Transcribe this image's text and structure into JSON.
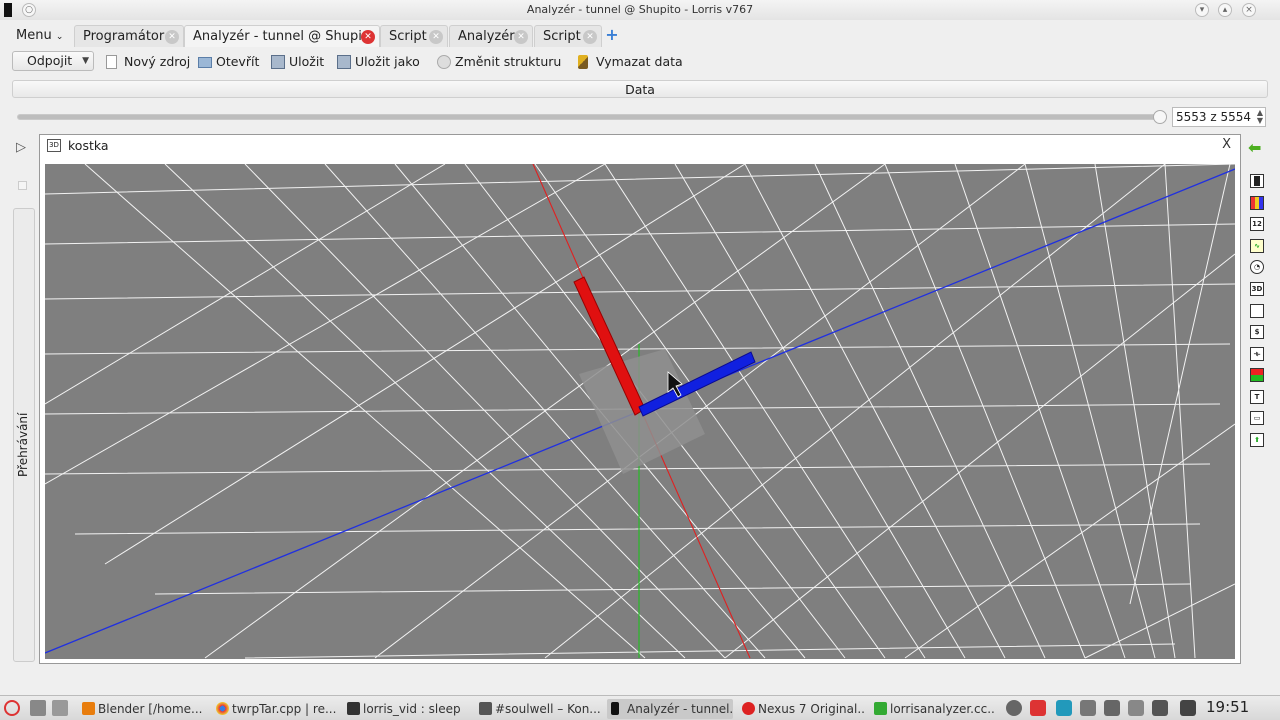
{
  "window": {
    "title": "Analyzér - tunnel @ Shupito - Lorris v767"
  },
  "tabbar": {
    "menu_label": "Menu",
    "tabs": [
      {
        "label": "Programátor"
      },
      {
        "label": "Analyzér - tunnel @ Shupi..."
      },
      {
        "label": "Script"
      },
      {
        "label": "Analyzér"
      },
      {
        "label": "Script"
      }
    ]
  },
  "toolbar": {
    "connection_combo": "Odpojit",
    "new_source": "Nový zdroj",
    "open": "Otevřít",
    "save": "Uložit",
    "save_as": "Uložit jako",
    "change_structure": "Změnit strukturu",
    "clear_data": "Vymazat data"
  },
  "data_bar": {
    "label": "Data"
  },
  "playback": {
    "position_text": "5553 z 5554",
    "progress": 0.9998,
    "tab_label": "Přehrávání"
  },
  "widget": {
    "title": "kostka",
    "type_icon": "3D",
    "close_label": "X"
  },
  "right_palette": [
    {
      "icon": "battery-icon"
    },
    {
      "icon": "color-bars-icon"
    },
    {
      "icon": "number-icon",
      "text": "12"
    },
    {
      "icon": "graph-icon"
    },
    {
      "icon": "clock-icon"
    },
    {
      "icon": "3d-icon",
      "text": "3D"
    },
    {
      "icon": "blank-icon"
    },
    {
      "icon": "script-icon"
    },
    {
      "icon": "slider-icon"
    },
    {
      "icon": "color-icon"
    },
    {
      "icon": "text-icon",
      "text": "T"
    },
    {
      "icon": "input-icon"
    },
    {
      "icon": "arrow-up-icon"
    }
  ],
  "taskbar": {
    "tasks": [
      {
        "label": "Blender [/home..."
      },
      {
        "label": "twrpTar.cpp | re..."
      },
      {
        "label": "lorris_vid : sleep"
      },
      {
        "label": "#soulwell – Kon..."
      },
      {
        "label": "Analyzér - tunnel..."
      },
      {
        "label": "Nexus 7 Original..."
      },
      {
        "label": "lorrisanalyzer.cc..."
      }
    ],
    "clock": "19:51"
  },
  "colors": {
    "axis_x": "#e02020",
    "axis_y": "#2030e0",
    "axis_z": "#20c020",
    "grid": "#ffffff",
    "viewport_bg": "#7f7f7f"
  }
}
